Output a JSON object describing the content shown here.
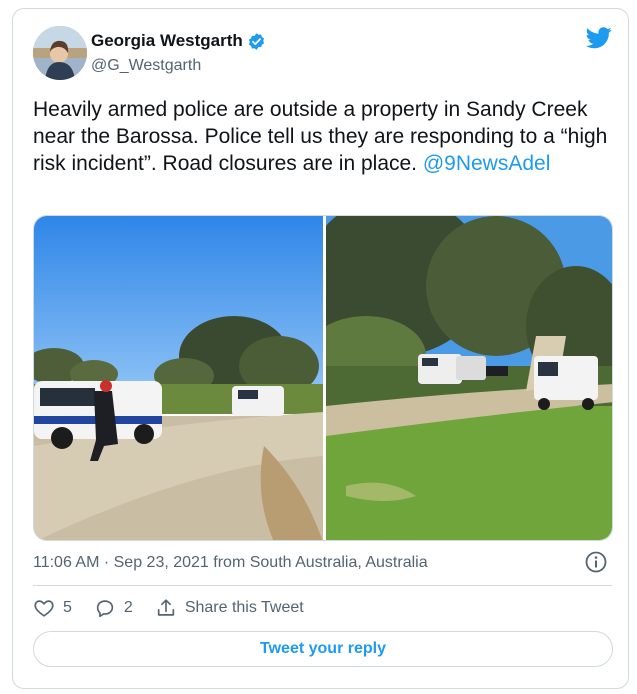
{
  "author": {
    "name": "Georgia Westgarth",
    "handle": "@G_Westgarth"
  },
  "tweet": {
    "text": "Heavily armed police are outside a property in Sandy Creek near the Barossa. Police tell us they are responding to a “high risk incident”. Road closures are in place. ",
    "mention": "@9NewsAdel"
  },
  "meta": {
    "timestamp": "11:06 AM · Sep 23, 2021 from South Australia, Australia"
  },
  "actions": {
    "likes": "5",
    "replies": "2",
    "share_label": "Share this Tweet"
  },
  "reply_button": {
    "label": "Tweet your reply"
  },
  "colors": {
    "accent": "#1d9bf0",
    "verified": "#1d9bf0",
    "text": "#0f1419",
    "muted": "#536471",
    "border": "#cfd9de"
  },
  "icons": [
    "verified-badge-icon",
    "twitter-bird-icon",
    "info-icon",
    "heart-icon",
    "reply-icon",
    "share-icon"
  ]
}
